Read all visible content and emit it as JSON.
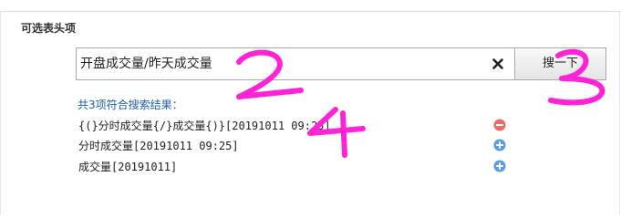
{
  "section_title": "可选表头项",
  "search": {
    "value": "开盘成交量/昨天成交量",
    "button_label": "搜一下"
  },
  "results": {
    "count_text": "共3项符合搜索结果：",
    "items": [
      {
        "text": "{(}分时成交量{/}成交量{)}[20191011 09:25]",
        "action": "remove"
      },
      {
        "text": "分时成交量[20191011 09:25]",
        "action": "add"
      },
      {
        "text": "成交量[20191011]",
        "action": "add"
      }
    ]
  },
  "annotations": {
    "labels": [
      "2",
      "3",
      "4"
    ]
  },
  "colors": {
    "remove": "#e86d6d",
    "add": "#5b9ae8",
    "annotation": "#ff22d6",
    "link": "#1e5ea5"
  }
}
